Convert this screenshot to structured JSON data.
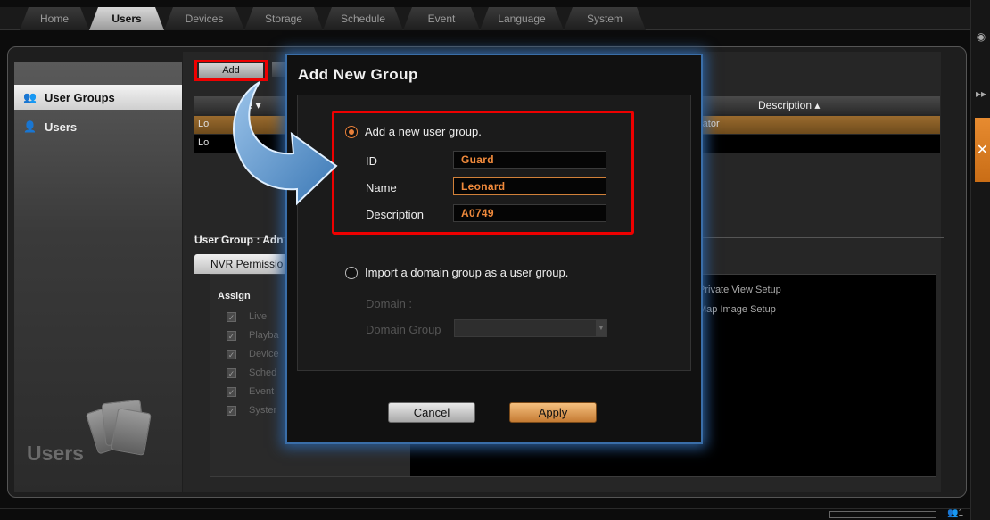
{
  "nav": {
    "tabs": [
      "Home",
      "Users",
      "Devices",
      "Storage",
      "Schedule",
      "Event",
      "Language",
      "System"
    ],
    "active_tab": "Users"
  },
  "sidebar": {
    "items": [
      {
        "label": "User Groups",
        "icon": "user-groups-icon",
        "selected": true
      },
      {
        "label": "Users",
        "icon": "user-icon",
        "selected": false
      }
    ],
    "logo_text": "Users"
  },
  "toolbar": {
    "add_label": "Add"
  },
  "grid": {
    "col_type": "pe ▾",
    "col_description": "Description ▴",
    "rows": [
      {
        "type": "Lo",
        "description": "rator"
      },
      {
        "type": "Lo",
        "description": ""
      }
    ]
  },
  "user_group": {
    "title": "User Group : Adn",
    "tab": "NVR Permissio",
    "assign_label": "Assign",
    "permissions": [
      "Live",
      "Playba",
      "Device",
      "Sched",
      "Event",
      "Syster"
    ],
    "right_items": [
      "Private View Setup",
      "Map Image Setup"
    ]
  },
  "modal": {
    "title": "Add New Group",
    "option_new": "Add a new user group.",
    "id_label": "ID",
    "id_value": "Guard",
    "name_label": "Name",
    "name_value": "Leonard",
    "description_label": "Description",
    "description_value": "A0749",
    "option_import": "Import a domain group as a user group.",
    "domain_label": "Domain :",
    "domain_group_label": "Domain Group",
    "cancel_label": "Cancel",
    "apply_label": "Apply"
  },
  "status": {
    "count": "1"
  },
  "colors": {
    "accent": "#e8803a",
    "highlight": "#e00000",
    "glow": "#2c5e99"
  }
}
